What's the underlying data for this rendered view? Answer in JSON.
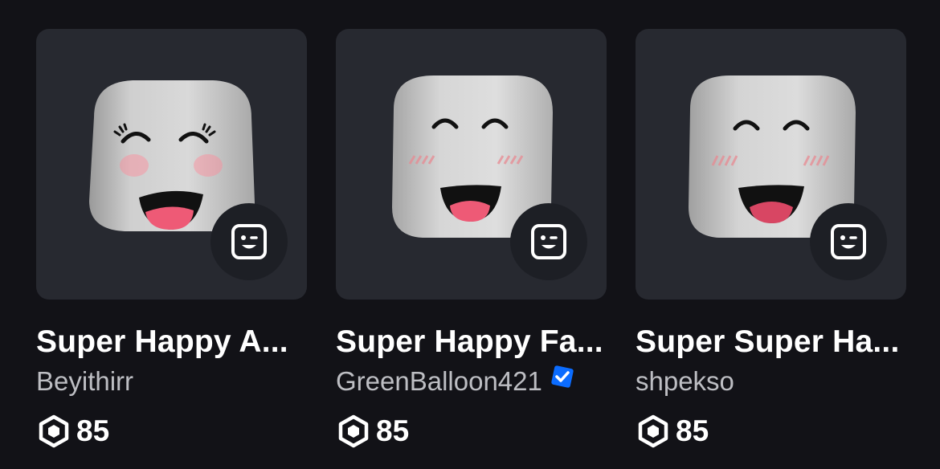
{
  "items": [
    {
      "title": "Super Happy A...",
      "creator": "Beyithirr",
      "verified": false,
      "price": "85",
      "price_icon": "robux-icon",
      "badge_icon": "wink-face-icon",
      "face_style": "eyelash-smile"
    },
    {
      "title": "Super Happy Fa...",
      "creator": "GreenBalloon421",
      "verified": true,
      "price": "85",
      "price_icon": "robux-icon",
      "badge_icon": "wink-face-icon",
      "face_style": "closed-eye-smile"
    },
    {
      "title": "Super Super Ha...",
      "creator": "shpekso",
      "verified": false,
      "price": "85",
      "price_icon": "robux-icon",
      "badge_icon": "wink-face-icon",
      "face_style": "closed-eye-smile"
    }
  ],
  "colors": {
    "background": "#121217",
    "card_bg": "#272930",
    "badge_bg": "#1d1f25",
    "title": "#ffffff",
    "creator": "#bdbec3",
    "verified": "#0b6cff"
  }
}
